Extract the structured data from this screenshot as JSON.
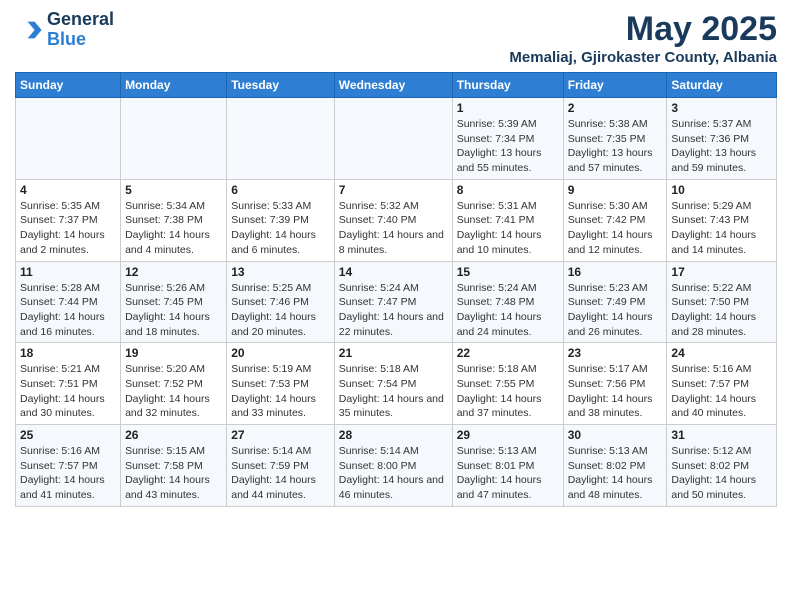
{
  "logo": {
    "general": "General",
    "blue": "Blue"
  },
  "title": "May 2025",
  "subtitle": "Memaliaj, Gjirokaster County, Albania",
  "days_of_week": [
    "Sunday",
    "Monday",
    "Tuesday",
    "Wednesday",
    "Thursday",
    "Friday",
    "Saturday"
  ],
  "weeks": [
    [
      {
        "day": "",
        "text": ""
      },
      {
        "day": "",
        "text": ""
      },
      {
        "day": "",
        "text": ""
      },
      {
        "day": "",
        "text": ""
      },
      {
        "day": "1",
        "text": "Sunrise: 5:39 AM\nSunset: 7:34 PM\nDaylight: 13 hours and 55 minutes."
      },
      {
        "day": "2",
        "text": "Sunrise: 5:38 AM\nSunset: 7:35 PM\nDaylight: 13 hours and 57 minutes."
      },
      {
        "day": "3",
        "text": "Sunrise: 5:37 AM\nSunset: 7:36 PM\nDaylight: 13 hours and 59 minutes."
      }
    ],
    [
      {
        "day": "4",
        "text": "Sunrise: 5:35 AM\nSunset: 7:37 PM\nDaylight: 14 hours and 2 minutes."
      },
      {
        "day": "5",
        "text": "Sunrise: 5:34 AM\nSunset: 7:38 PM\nDaylight: 14 hours and 4 minutes."
      },
      {
        "day": "6",
        "text": "Sunrise: 5:33 AM\nSunset: 7:39 PM\nDaylight: 14 hours and 6 minutes."
      },
      {
        "day": "7",
        "text": "Sunrise: 5:32 AM\nSunset: 7:40 PM\nDaylight: 14 hours and 8 minutes."
      },
      {
        "day": "8",
        "text": "Sunrise: 5:31 AM\nSunset: 7:41 PM\nDaylight: 14 hours and 10 minutes."
      },
      {
        "day": "9",
        "text": "Sunrise: 5:30 AM\nSunset: 7:42 PM\nDaylight: 14 hours and 12 minutes."
      },
      {
        "day": "10",
        "text": "Sunrise: 5:29 AM\nSunset: 7:43 PM\nDaylight: 14 hours and 14 minutes."
      }
    ],
    [
      {
        "day": "11",
        "text": "Sunrise: 5:28 AM\nSunset: 7:44 PM\nDaylight: 14 hours and 16 minutes."
      },
      {
        "day": "12",
        "text": "Sunrise: 5:26 AM\nSunset: 7:45 PM\nDaylight: 14 hours and 18 minutes."
      },
      {
        "day": "13",
        "text": "Sunrise: 5:25 AM\nSunset: 7:46 PM\nDaylight: 14 hours and 20 minutes."
      },
      {
        "day": "14",
        "text": "Sunrise: 5:24 AM\nSunset: 7:47 PM\nDaylight: 14 hours and 22 minutes."
      },
      {
        "day": "15",
        "text": "Sunrise: 5:24 AM\nSunset: 7:48 PM\nDaylight: 14 hours and 24 minutes."
      },
      {
        "day": "16",
        "text": "Sunrise: 5:23 AM\nSunset: 7:49 PM\nDaylight: 14 hours and 26 minutes."
      },
      {
        "day": "17",
        "text": "Sunrise: 5:22 AM\nSunset: 7:50 PM\nDaylight: 14 hours and 28 minutes."
      }
    ],
    [
      {
        "day": "18",
        "text": "Sunrise: 5:21 AM\nSunset: 7:51 PM\nDaylight: 14 hours and 30 minutes."
      },
      {
        "day": "19",
        "text": "Sunrise: 5:20 AM\nSunset: 7:52 PM\nDaylight: 14 hours and 32 minutes."
      },
      {
        "day": "20",
        "text": "Sunrise: 5:19 AM\nSunset: 7:53 PM\nDaylight: 14 hours and 33 minutes."
      },
      {
        "day": "21",
        "text": "Sunrise: 5:18 AM\nSunset: 7:54 PM\nDaylight: 14 hours and 35 minutes."
      },
      {
        "day": "22",
        "text": "Sunrise: 5:18 AM\nSunset: 7:55 PM\nDaylight: 14 hours and 37 minutes."
      },
      {
        "day": "23",
        "text": "Sunrise: 5:17 AM\nSunset: 7:56 PM\nDaylight: 14 hours and 38 minutes."
      },
      {
        "day": "24",
        "text": "Sunrise: 5:16 AM\nSunset: 7:57 PM\nDaylight: 14 hours and 40 minutes."
      }
    ],
    [
      {
        "day": "25",
        "text": "Sunrise: 5:16 AM\nSunset: 7:57 PM\nDaylight: 14 hours and 41 minutes."
      },
      {
        "day": "26",
        "text": "Sunrise: 5:15 AM\nSunset: 7:58 PM\nDaylight: 14 hours and 43 minutes."
      },
      {
        "day": "27",
        "text": "Sunrise: 5:14 AM\nSunset: 7:59 PM\nDaylight: 14 hours and 44 minutes."
      },
      {
        "day": "28",
        "text": "Sunrise: 5:14 AM\nSunset: 8:00 PM\nDaylight: 14 hours and 46 minutes."
      },
      {
        "day": "29",
        "text": "Sunrise: 5:13 AM\nSunset: 8:01 PM\nDaylight: 14 hours and 47 minutes."
      },
      {
        "day": "30",
        "text": "Sunrise: 5:13 AM\nSunset: 8:02 PM\nDaylight: 14 hours and 48 minutes."
      },
      {
        "day": "31",
        "text": "Sunrise: 5:12 AM\nSunset: 8:02 PM\nDaylight: 14 hours and 50 minutes."
      }
    ]
  ]
}
